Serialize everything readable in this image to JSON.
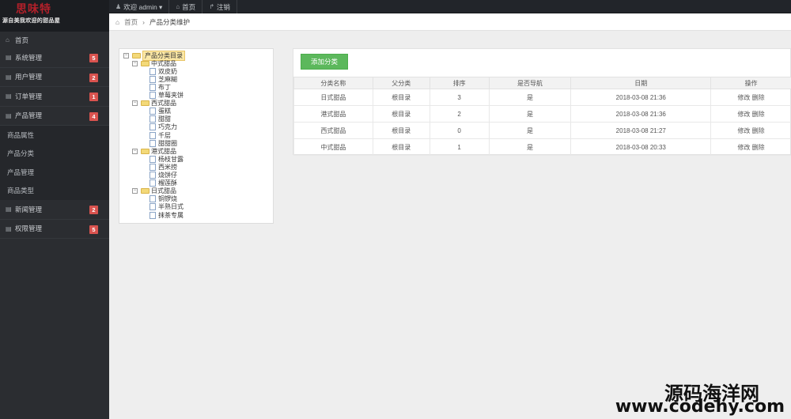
{
  "logo": {
    "title": "思味特",
    "subtitle": "源自美我欢迎的甜品屋"
  },
  "topbar": {
    "links": [
      {
        "icon": "user-icon",
        "glyph": "♟",
        "label": "欢迎 admin ▾"
      },
      {
        "icon": "home-icon",
        "glyph": "⌂",
        "label": "首页"
      },
      {
        "icon": "logout-icon",
        "glyph": "↱",
        "label": "注销"
      }
    ]
  },
  "sidebar": {
    "home": {
      "icon": "home-icon",
      "glyph": "⌂",
      "label": "首页"
    },
    "items": [
      {
        "glyph": "▤",
        "label": "系统管理",
        "badge": "5"
      },
      {
        "glyph": "▤",
        "label": "用户管理",
        "badge": "2"
      },
      {
        "glyph": "▤",
        "label": "订单管理",
        "badge": "1"
      },
      {
        "glyph": "▤",
        "label": "产品管理",
        "badge": "4"
      }
    ],
    "subitems": [
      "商品属性",
      "产品分类",
      "产品管理",
      "商品类型"
    ],
    "items_after": [
      {
        "glyph": "▤",
        "label": "新闻管理",
        "badge": "2"
      },
      {
        "glyph": "▤",
        "label": "权限管理",
        "badge": "5"
      }
    ]
  },
  "breadcrumb": {
    "home_glyph": "⌂",
    "home": "首页",
    "sep": "›",
    "current": "产品分类维护"
  },
  "tree": {
    "root": "产品分类目录",
    "groups": [
      {
        "label": "中式甜品",
        "children": [
          "双皮奶",
          "芝麻糊",
          "布丁",
          "草莓夹饼"
        ]
      },
      {
        "label": "西式甜品",
        "children": [
          "蛋糕",
          "甜甜",
          "巧克力",
          "千层",
          "甜甜圈"
        ]
      },
      {
        "label": "港式甜品",
        "children": [
          "杨枝甘露",
          "西米捞",
          "烧饼仔",
          "榴莲酥"
        ]
      },
      {
        "label": "日式甜品",
        "children": [
          "铜锣烧",
          "半熟日式",
          "抹茶专属"
        ]
      }
    ]
  },
  "content": {
    "add_button": "添加分类",
    "columns": [
      "分类名称",
      "父分类",
      "排序",
      "是否导航",
      "日期",
      "操作"
    ],
    "rows": [
      [
        "日式甜品",
        "根目录",
        "3",
        "是",
        "2018-03-08 21:36"
      ],
      [
        "港式甜品",
        "根目录",
        "2",
        "是",
        "2018-03-08 21:36"
      ],
      [
        "西式甜品",
        "根目录",
        "0",
        "是",
        "2018-03-08 21:27"
      ],
      [
        "中式甜品",
        "根目录",
        "1",
        "是",
        "2018-03-08 20:33"
      ]
    ],
    "op_edit": "修改",
    "op_delete": "删除"
  },
  "watermark": {
    "line1": "源码海洋网",
    "line2": "www.codehy.com"
  }
}
